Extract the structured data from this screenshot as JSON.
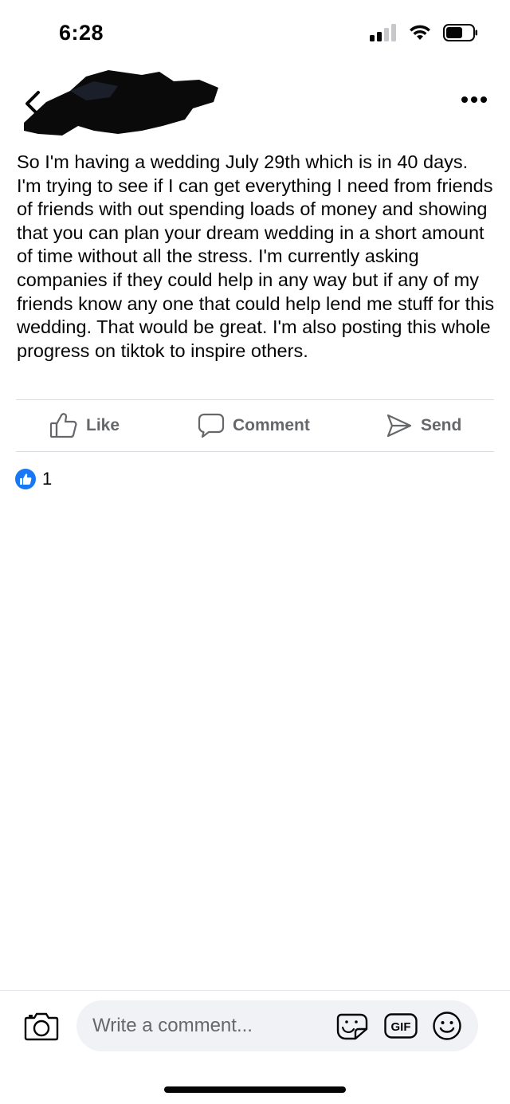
{
  "status_bar": {
    "time": "6:28",
    "signal_icon": "cellular-signal-icon",
    "wifi_icon": "wifi-icon",
    "battery_icon": "battery-icon"
  },
  "header": {
    "back_icon": "chevron-left-icon",
    "more_icon": "more-dots-icon"
  },
  "post": {
    "text": "So I'm having a wedding July 29th which is in 40 days. I'm trying to see if I can get everything I need from friends of friends with out spending loads of money and showing that you can plan your dream wedding in a short amount of time without all the stress. I'm currently asking companies if they could help in any way but if any of my friends know any one that could help lend me stuff for this wedding. That would be great. I'm also posting this whole progress on tiktok to inspire others."
  },
  "actions": {
    "like_label": "Like",
    "comment_label": "Comment",
    "send_label": "Send"
  },
  "reactions": {
    "count": "1",
    "icon": "like-reaction-icon"
  },
  "composer": {
    "placeholder": "Write a comment...",
    "gif_label": "GIF",
    "camera_icon": "camera-icon",
    "sticker_icon": "sticker-icon",
    "emoji_icon": "emoji-icon"
  },
  "colors": {
    "text": "#050505",
    "secondary_text": "#65676b",
    "accent": "#1877f2",
    "divider": "#dadde1",
    "input_bg": "#f0f2f5"
  }
}
